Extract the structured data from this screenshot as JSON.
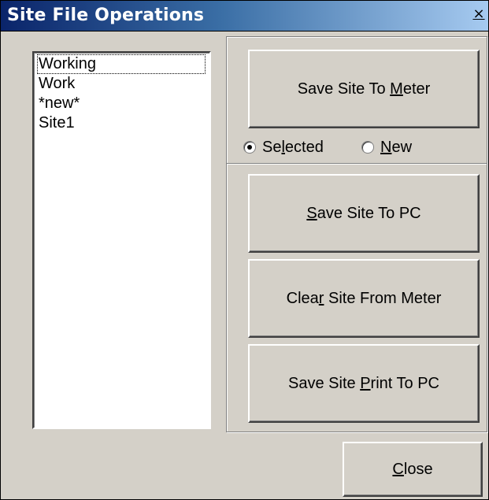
{
  "window": {
    "title": "Site File Operations",
    "close_glyph": "×"
  },
  "site_list": {
    "items": [
      "Working",
      "Work",
      "*new*",
      "Site1"
    ],
    "focused_index": 0
  },
  "buttons": {
    "save_to_meter": {
      "before": "Save Site To ",
      "mnemonic": "M",
      "after": "eter"
    },
    "save_to_pc": {
      "before": "",
      "mnemonic": "S",
      "after": "ave Site To PC"
    },
    "clear_from_meter": {
      "before": "Clea",
      "mnemonic": "r",
      "after": " Site From Meter"
    },
    "save_print_to_pc": {
      "before": "Save Site ",
      "mnemonic": "P",
      "after": "rint To PC"
    },
    "close": {
      "before": "",
      "mnemonic": "C",
      "after": "lose"
    }
  },
  "radios": {
    "selected": {
      "before": "Se",
      "mnemonic": "l",
      "after": "ected",
      "checked": true
    },
    "new": {
      "before": "",
      "mnemonic": "N",
      "after": "ew",
      "checked": false
    }
  },
  "colors": {
    "dialog_face": "#d4d0c8",
    "title_gradient_start": "#0a246a",
    "title_gradient_end": "#a6caf0"
  }
}
